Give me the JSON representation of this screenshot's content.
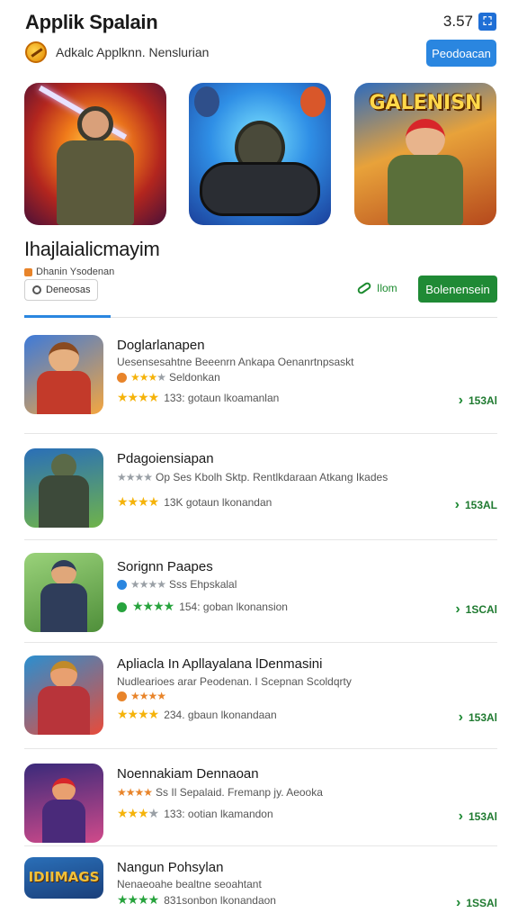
{
  "header": {
    "title": "Applik Spalain",
    "status_time": "3.57",
    "status_icon_name": "accessibility-icon",
    "developer": "Adkalc Applknn. Nenslurian",
    "top_button_label": "Peodoacan"
  },
  "featured": [
    {
      "icon": "ninja-warrior-art"
    },
    {
      "icon": "gamepad-art"
    },
    {
      "icon": "hero-poster-art",
      "logo_text": "GALENISN"
    }
  ],
  "section": {
    "title": "Ihajlaialicmayim",
    "meta": "Dhanin Ysodenan",
    "chip_label": "Deneosas",
    "link_label": "Ilom",
    "install_label": "Bolenensein"
  },
  "list": [
    {
      "title": "Doglarlanapen",
      "subtitle": "Uesensesahtne Beeenrn Ankapa Oenanrtnpsaskt",
      "sub_rating_label": "Seldonkan",
      "rating_label": "133: gotaun lkoamanlan",
      "action_label": "153Al",
      "rating": 4,
      "colors": {
        "bg1": "#3d7ad9",
        "bg2": "#f4a640",
        "body": "#c33a2a",
        "head": "#e6b080"
      }
    },
    {
      "title": "Pdagoiensiapan",
      "subtitle": "Op Ses Kbolh Sktp. Rentlkdaraan Atkang Ikades",
      "sub_rating_label": "",
      "rating_label": "13K gotaun lkonandan",
      "action_label": "153AL",
      "rating": 4,
      "colors": {
        "bg1": "#2a6fb8",
        "bg2": "#6fb34a",
        "body": "#3d4a3a",
        "head": "#5b6a48"
      }
    },
    {
      "title": "Sorignn Paapes",
      "subtitle": "Sss Ehpskalal",
      "sub_rating_label": "",
      "rating_label": "154: goban lkonansion",
      "action_label": "1SCAl",
      "rating": 5,
      "colors": {
        "bg1": "#9ad27a",
        "bg2": "#4f8f3a",
        "body": "#2f3d5a",
        "head": "#e0a77a"
      }
    },
    {
      "title": "Apliacla In Apllayalana lDenmasini",
      "subtitle": "Nudlearioes arar Peodenan. I Scepnan Scoldqrty",
      "sub_rating_label": "",
      "rating_label": "234. gbaun lkonandaan",
      "action_label": "153Al",
      "rating": 4,
      "colors": {
        "bg1": "#2a8fd0",
        "bg2": "#e84b3a",
        "body": "#b8343a",
        "head": "#e8a070"
      }
    },
    {
      "title": "Noennakiam Dennaoan",
      "subtitle": "Ss Il Sepalaid. Fremanp jy. Aeooka",
      "sub_rating_label": "",
      "rating_label": "133: ootian lkamandon",
      "action_label": "153Al",
      "rating": 3,
      "colors": {
        "bg1": "#3a2a7a",
        "bg2": "#d04a8a",
        "body": "#4a2a7a",
        "head": "#e8a070"
      }
    },
    {
      "title": "Nangun Pohsylan",
      "subtitle": "Nenaeoahe bealtne seoahtant",
      "sub_rating_label": "",
      "rating_label": "831sonbon lkonandaon",
      "action_label": "1SSAl",
      "rating": 5,
      "colors": {
        "bg1": "#f0c13a",
        "bg2": "#2a6fb8",
        "body": "#2a3f7a",
        "head": "#f0c13a"
      },
      "thumb_text": "IDIIMAGS"
    }
  ]
}
